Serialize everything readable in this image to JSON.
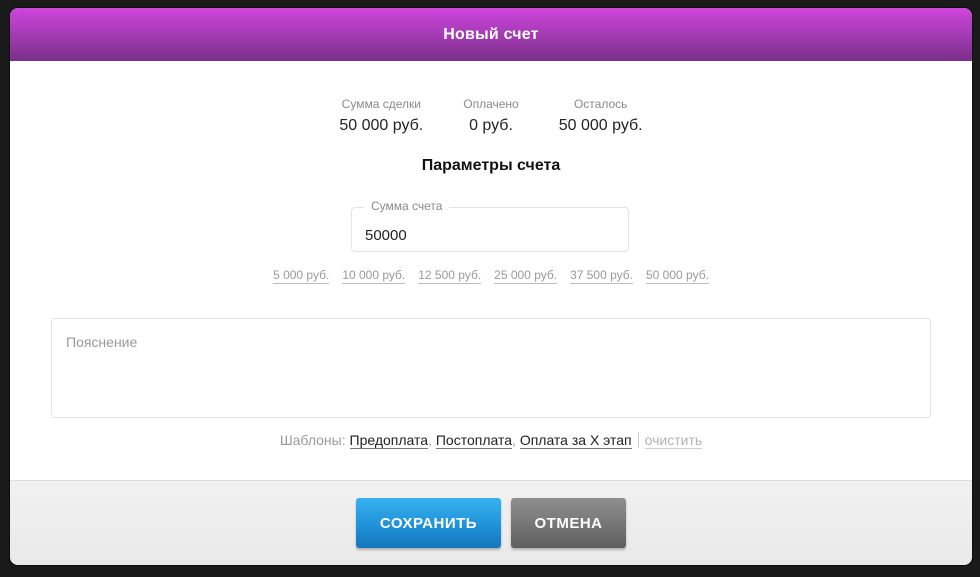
{
  "modal": {
    "title": "Новый счет"
  },
  "stats": [
    {
      "label": "Сумма сделки",
      "value": "50 000 руб."
    },
    {
      "label": "Оплачено",
      "value": "0 руб."
    },
    {
      "label": "Осталось",
      "value": "50 000 руб."
    }
  ],
  "params": {
    "title": "Параметры счета"
  },
  "amount": {
    "label": "Сумма счета",
    "value": "50000"
  },
  "presets": [
    "5 000 руб.",
    "10 000 руб.",
    "12 500 руб.",
    "25 000 руб.",
    "37 500 руб.",
    "50 000 руб."
  ],
  "comment": {
    "placeholder": "Пояснение"
  },
  "templates": {
    "label": "Шаблоны:",
    "items": [
      "Предоплата",
      "Постоплата",
      "Оплата за X этап"
    ],
    "separator": ",",
    "clear": "очистить"
  },
  "footer": {
    "save_label": "СОХРАНИТЬ",
    "cancel_label": "ОТМЕНА"
  },
  "colors": {
    "header_start": "#cf45dd",
    "header_end": "#7a2f88",
    "save": "#1e8fd6",
    "cancel": "#737373"
  }
}
